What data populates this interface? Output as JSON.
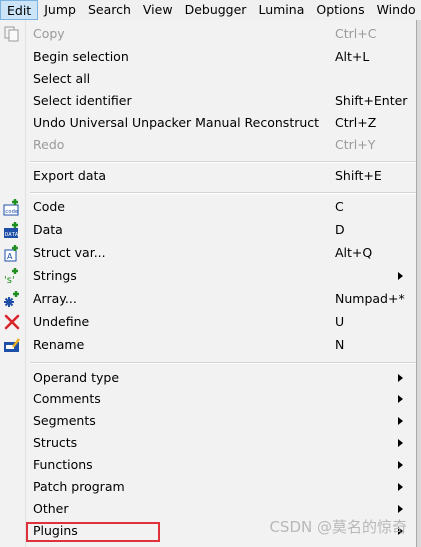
{
  "menubar": {
    "items": [
      {
        "label": "Edit",
        "active": true
      },
      {
        "label": "Jump"
      },
      {
        "label": "Search"
      },
      {
        "label": "View"
      },
      {
        "label": "Debugger"
      },
      {
        "label": "Lumina"
      },
      {
        "label": "Options"
      },
      {
        "label": "Windo"
      }
    ]
  },
  "menu": {
    "copy": {
      "label": "Copy",
      "shortcut": "Ctrl+C",
      "icon": "copy-icon"
    },
    "begin_selection": {
      "label": "Begin selection",
      "shortcut": "Alt+L"
    },
    "select_all": {
      "label": "Select all",
      "shortcut": ""
    },
    "select_identifier": {
      "label": "Select identifier",
      "shortcut": "Shift+Enter"
    },
    "undo": {
      "label": "Undo Universal Unpacker Manual Reconstruct",
      "shortcut": "Ctrl+Z"
    },
    "redo": {
      "label": "Redo",
      "shortcut": "Ctrl+Y"
    },
    "export_data": {
      "label": "Export data",
      "shortcut": "Shift+E"
    },
    "code": {
      "label": "Code",
      "shortcut": "C",
      "icon": "code-icon"
    },
    "data": {
      "label": "Data",
      "shortcut": "D",
      "icon": "data-icon"
    },
    "struct_var": {
      "label": "Struct var...",
      "shortcut": "Alt+Q",
      "icon": "struct-var-icon"
    },
    "strings": {
      "label": "Strings",
      "icon": "strings-icon"
    },
    "array": {
      "label": "Array...",
      "shortcut": "Numpad+*",
      "icon": "array-icon"
    },
    "undefine": {
      "label": "Undefine",
      "shortcut": "U",
      "icon": "undefine-icon"
    },
    "rename": {
      "label": "Rename",
      "shortcut": "N",
      "icon": "rename-icon"
    },
    "operand_type": {
      "label": "Operand type"
    },
    "comments": {
      "label": "Comments"
    },
    "segments": {
      "label": "Segments"
    },
    "structs": {
      "label": "Structs"
    },
    "functions": {
      "label": "Functions"
    },
    "patch_program": {
      "label": "Patch program"
    },
    "other": {
      "label": "Other"
    },
    "plugins": {
      "label": "Plugins"
    }
  },
  "colors": {
    "highlight_box": "#e0313a",
    "menubar_active_bg": "#cce4f7",
    "icon_green": "#1f8f1f",
    "icon_blue": "#1e4fa8",
    "icon_red": "#d8262a"
  },
  "watermark": "CSDN @莫名的惊奇"
}
